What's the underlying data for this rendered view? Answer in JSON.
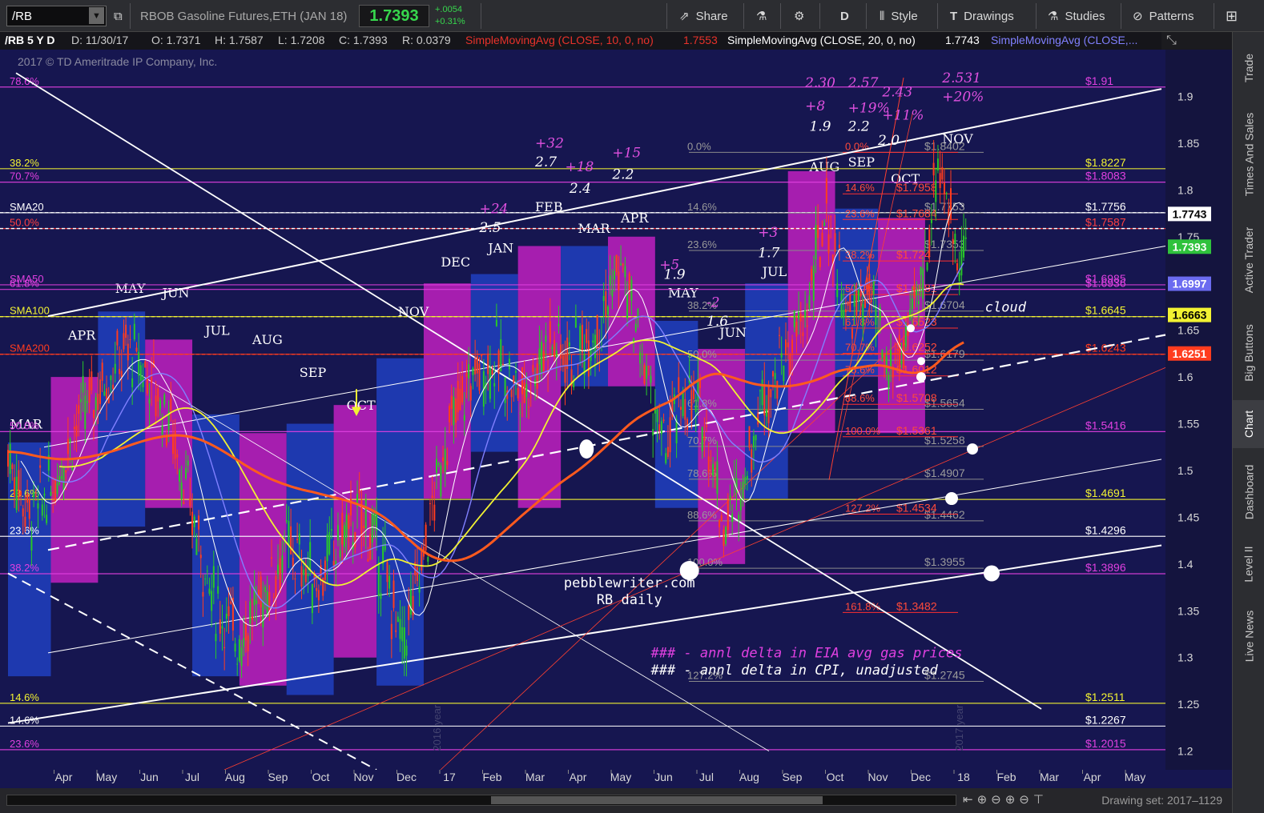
{
  "toolbar": {
    "symbol": "/RB",
    "description": "RBOB Gasoline Futures,ETH (JAN 18)",
    "last": "1.7393",
    "change": "+.0054",
    "change_pct": "+0.31%",
    "buttons": [
      "Share",
      "D",
      "Style",
      "Drawings",
      "Studies",
      "Patterns"
    ]
  },
  "study_header": {
    "symbol_period": "/RB 5 Y D",
    "date": "D: 11/30/17",
    "open": "O: 1.7371",
    "high": "H: 1.7587",
    "low": "L: 1.7208",
    "close": "C: 1.7393",
    "range": "R: 0.0379",
    "sma10_label": "SimpleMovingAvg (CLOSE, 10, 0, no)",
    "sma10_value": "1.7553",
    "sma20_label": "SimpleMovingAvg (CLOSE, 20, 0, no)",
    "sma20_value": "1.7743",
    "sma50_label": "SimpleMovingAvg (CLOSE,...",
    "colors": {
      "sma10": "#e8322a",
      "sma20": "#ffffff",
      "sma50": "#8080ff",
      "sma100": "#f2f232",
      "sma200": "#ff5a1e"
    }
  },
  "watermark": "2017 © TD Ameritrade IP Company, Inc.",
  "right_tabs": [
    "Trade",
    "Times And Sales",
    "Active Trader",
    "Big Buttons",
    "Chart",
    "Dashboard",
    "Level II",
    "Live News"
  ],
  "bottom_bar": {
    "drawing_set": "Drawing set: 2017–1129"
  },
  "chart_data": {
    "type": "candlestick",
    "ylim": [
      1.18,
      1.95
    ],
    "y_ticks": [
      "1.9",
      "1.85",
      "1.8",
      "1.75",
      "1.7",
      "1.65",
      "1.6",
      "1.55",
      "1.5",
      "1.45",
      "1.4",
      "1.35",
      "1.3",
      "1.25",
      "1.2"
    ],
    "x_ticks": [
      "Apr",
      "May",
      "Jun",
      "Jul",
      "Aug",
      "Sep",
      "Oct",
      "Nov",
      "Dec",
      "17",
      "Feb",
      "Mar",
      "Apr",
      "May",
      "Jun",
      "Jul",
      "Aug",
      "Sep",
      "Oct",
      "Nov",
      "Dec",
      "18",
      "Feb",
      "Mar",
      "Apr",
      "May"
    ],
    "year_markers": [
      "2016 year",
      "2017 year"
    ],
    "price_badges": [
      {
        "text": "1.7743",
        "value": 1.7743,
        "bg": "#ffffff",
        "fg": "#000000"
      },
      {
        "text": "1.7393",
        "value": 1.7393,
        "bg": "#2fc23c",
        "fg": "#ffffff"
      },
      {
        "text": "1.6997",
        "value": 1.6997,
        "bg": "#6b6bf0",
        "fg": "#ffffff"
      },
      {
        "text": "1.6663",
        "value": 1.6663,
        "bg": "#f2f232",
        "fg": "#000000"
      },
      {
        "text": "1.6251",
        "value": 1.6251,
        "bg": "#ff3c1e",
        "fg": "#ffffff"
      }
    ],
    "level_lines": [
      {
        "label": "78.6%",
        "price": "$1.91",
        "value": 1.91,
        "color": "#e040e0"
      },
      {
        "label": "38.2%",
        "price": "$1.8227",
        "value": 1.8227,
        "color": "#f2f232"
      },
      {
        "label": "70.7%",
        "price": "$1.8083",
        "value": 1.8083,
        "color": "#e040e0"
      },
      {
        "label": "SMA20",
        "price": "$1.7756",
        "value": 1.7756,
        "color": "#ffffff"
      },
      {
        "label": "50.0%",
        "price": "$1.7587",
        "value": 1.7587,
        "color": "#ff4040"
      },
      {
        "label": "61.8%",
        "price": "$1.6936",
        "value": 1.6936,
        "color": "#e040e0"
      },
      {
        "label": "SMA50",
        "price": "$1.6985",
        "value": 1.6985,
        "color": "#e040e0"
      },
      {
        "label": "SMA100",
        "price": "$1.6645",
        "value": 1.6645,
        "color": "#f2f232"
      },
      {
        "label": "SMA200",
        "price": "$1.6243",
        "value": 1.6243,
        "color": "#ff3c1e"
      },
      {
        "label": "50.0%",
        "price": "$1.5416",
        "value": 1.5416,
        "color": "#e040e0"
      },
      {
        "label": "23.6%",
        "price": "$1.4691",
        "value": 1.4691,
        "color": "#f2f232"
      },
      {
        "label": "23.6%",
        "price": "$1.4296",
        "value": 1.4296,
        "color": "#ffffff"
      },
      {
        "label": "38.2%",
        "price": "$1.3896",
        "value": 1.3896,
        "color": "#e040e0"
      },
      {
        "label": "14.6%",
        "price": "$1.2511",
        "value": 1.2511,
        "color": "#f2f232"
      },
      {
        "label": "14.6%",
        "price": "$1.2267",
        "value": 1.2267,
        "color": "#ffffff"
      },
      {
        "label": "23.6%",
        "price": "$1.2015",
        "value": 1.2015,
        "color": "#e040e0"
      }
    ],
    "grey_fib": [
      {
        "label": "0.0%",
        "price": "$1.8402",
        "value": 1.8402
      },
      {
        "label": "14.6%",
        "price": "$1.7753",
        "value": 1.7753
      },
      {
        "label": "23.6%",
        "price": "$1.7353",
        "value": 1.7353
      },
      {
        "label": "38.2%",
        "price": "$1.6704",
        "value": 1.6704
      },
      {
        "label": "50.0%",
        "price": "$1.6179",
        "value": 1.6179
      },
      {
        "label": "61.8%",
        "price": "$1.5654",
        "value": 1.5654
      },
      {
        "label": "70.7%",
        "price": "$1.5258",
        "value": 1.5258
      },
      {
        "label": "78.6%",
        "price": "$1.4907",
        "value": 1.4907
      },
      {
        "label": "88.6%",
        "price": "$1.4462",
        "value": 1.4462
      },
      {
        "label": "100.0%",
        "price": "$1.3955",
        "value": 1.3955
      },
      {
        "label": "127.2%",
        "price": "$1.2745",
        "value": 1.2745
      }
    ],
    "red_fib": [
      {
        "label": "0.0%",
        "value": 1.8402
      },
      {
        "label": "14.6%",
        "price": "$1.7958",
        "value": 1.7958
      },
      {
        "label": "23.6%",
        "price": "$1.7684",
        "value": 1.7684
      },
      {
        "label": "38.2%",
        "price": "$1.724",
        "value": 1.724
      },
      {
        "label": "50.0%",
        "price": "$1.6881",
        "value": 1.6881
      },
      {
        "label": "61.8%",
        "price": "$1.6523",
        "value": 1.6523
      },
      {
        "label": "70.7%",
        "price": "$1.6252",
        "value": 1.6252
      },
      {
        "label": "78.6%",
        "price": "$1.6012",
        "value": 1.6012
      },
      {
        "label": "88.6%",
        "price": "$1.5708",
        "value": 1.5708
      },
      {
        "label": "100.0%",
        "price": "$1.5361",
        "value": 1.5361
      },
      {
        "label": "127.2%",
        "price": "$1.4534",
        "value": 1.4534
      },
      {
        "label": "161.8%",
        "price": "$1.3482",
        "value": 1.3482
      }
    ],
    "seasonal_boxes": [
      {
        "label": "MAR",
        "color": "#2040c0",
        "start": 0,
        "end": 1,
        "low": 1.28,
        "high": 1.53
      },
      {
        "label": "APR",
        "color": "#c020c0",
        "start": 1,
        "end": 2.1,
        "low": 1.38,
        "high": 1.6
      },
      {
        "label": "MAY",
        "color": "#2040c0",
        "start": 2.1,
        "end": 3.2,
        "low": 1.44,
        "high": 1.67
      },
      {
        "label": "JUN",
        "color": "#c020c0",
        "start": 3.2,
        "end": 4.3,
        "low": 1.46,
        "high": 1.64
      },
      {
        "label": "JUL",
        "color": "#2040c0",
        "start": 4.3,
        "end": 5.4,
        "low": 1.28,
        "high": 1.56
      },
      {
        "label": "AUG",
        "color": "#c020c0",
        "start": 5.4,
        "end": 6.5,
        "low": 1.27,
        "high": 1.54
      },
      {
        "label": "SEP",
        "color": "#2040c0",
        "start": 6.5,
        "end": 7.6,
        "low": 1.26,
        "high": 1.55
      },
      {
        "label": "OCT",
        "color": "#c020c0",
        "start": 7.6,
        "end": 8.6,
        "low": 1.3,
        "high": 1.57
      },
      {
        "label": "NOV",
        "color": "#2040c0",
        "start": 8.6,
        "end": 9.7,
        "low": 1.27,
        "high": 1.62
      },
      {
        "label": "DEC",
        "color": "#c020c0",
        "start": 9.7,
        "end": 10.8,
        "low": 1.47,
        "high": 1.7
      },
      {
        "label": "JAN",
        "color": "#2040c0",
        "start": 10.8,
        "end": 11.9,
        "low": 1.52,
        "high": 1.71
      },
      {
        "label": "FEB",
        "color": "#c020c0",
        "start": 11.9,
        "end": 12.9,
        "low": 1.46,
        "high": 1.74
      },
      {
        "label": "MAR",
        "color": "#2040c0",
        "start": 12.9,
        "end": 14,
        "low": 1.59,
        "high": 1.74
      },
      {
        "label": "APR",
        "color": "#c020c0",
        "start": 14,
        "end": 15.1,
        "low": 1.59,
        "high": 1.75
      },
      {
        "label": "MAY",
        "color": "#2040c0",
        "start": 15.1,
        "end": 16.1,
        "low": 1.46,
        "high": 1.66
      },
      {
        "label": "JUN",
        "color": "#c020c0",
        "start": 16.1,
        "end": 17.2,
        "low": 1.4,
        "high": 1.63
      },
      {
        "label": "JUL",
        "color": "#2040c0",
        "start": 17.2,
        "end": 18.2,
        "low": 1.47,
        "high": 1.7
      },
      {
        "label": "AUG",
        "color": "#c020c0",
        "start": 18.2,
        "end": 19.3,
        "low": 1.54,
        "high": 1.82
      },
      {
        "label": "SEP",
        "color": "#2040c0",
        "start": 19.3,
        "end": 20.3,
        "low": 1.6,
        "high": 1.78
      },
      {
        "label": "OCT",
        "color": "#c020c0",
        "start": 20.3,
        "end": 21.4,
        "low": 1.54,
        "high": 1.77
      }
    ],
    "month_labels": [
      {
        "text": "MAR",
        "m": 0.05,
        "v": 1.545
      },
      {
        "text": "APR",
        "m": 1.4,
        "v": 1.64
      },
      {
        "text": "MAY",
        "m": 2.5,
        "v": 1.69
      },
      {
        "text": "JUN",
        "m": 3.6,
        "v": 1.685
      },
      {
        "text": "JUL",
        "m": 4.6,
        "v": 1.645
      },
      {
        "text": "AUG",
        "m": 5.7,
        "v": 1.635
      },
      {
        "text": "SEP",
        "m": 6.8,
        "v": 1.6
      },
      {
        "text": "OCT",
        "m": 7.9,
        "v": 1.565
      },
      {
        "text": "NOV",
        "m": 9.1,
        "v": 1.665
      },
      {
        "text": "DEC",
        "m": 10.1,
        "v": 1.718
      },
      {
        "text": "JAN",
        "m": 11.2,
        "v": 1.733
      },
      {
        "text": "FEB",
        "m": 12.3,
        "v": 1.777
      },
      {
        "text": "MAR",
        "m": 13.3,
        "v": 1.754
      },
      {
        "text": "APR",
        "m": 14.3,
        "v": 1.765
      },
      {
        "text": "MAY",
        "m": 15.4,
        "v": 1.685
      },
      {
        "text": "JUN",
        "m": 16.6,
        "v": 1.643
      },
      {
        "text": "JUL",
        "m": 17.6,
        "v": 1.708
      },
      {
        "text": "AUG",
        "m": 18.7,
        "v": 1.82
      },
      {
        "text": "SEP",
        "m": 19.6,
        "v": 1.825
      },
      {
        "text": "OCT",
        "m": 20.6,
        "v": 1.807
      },
      {
        "text": "NOV",
        "m": 21.8,
        "v": 1.85
      }
    ],
    "annotations_eia": [
      {
        "text": "+24",
        "m": 11,
        "v": 1.775
      },
      {
        "text": "+32",
        "m": 12.3,
        "v": 1.845
      },
      {
        "text": "+18",
        "m": 13,
        "v": 1.82
      },
      {
        "text": "+15",
        "m": 14.1,
        "v": 1.835
      },
      {
        "text": "+5",
        "m": 15.2,
        "v": 1.715
      },
      {
        "text": "-2",
        "m": 16.3,
        "v": 1.675
      },
      {
        "text": "+3",
        "m": 17.5,
        "v": 1.75
      },
      {
        "text": "2.30",
        "m": 18.6,
        "v": 1.91
      },
      {
        "text": "+8",
        "m": 18.6,
        "v": 1.885
      },
      {
        "text": "2.57",
        "m": 19.6,
        "v": 1.91
      },
      {
        "text": "+19%",
        "m": 19.6,
        "v": 1.883
      },
      {
        "text": "2.43",
        "m": 20.4,
        "v": 1.9
      },
      {
        "text": "+11%",
        "m": 20.4,
        "v": 1.875
      },
      {
        "text": "2.531",
        "m": 21.8,
        "v": 1.915
      },
      {
        "text": "+20%",
        "m": 21.8,
        "v": 1.895
      }
    ],
    "annotations_cpi": [
      {
        "text": "2.5",
        "m": 11,
        "v": 1.755
      },
      {
        "text": "2.7",
        "m": 12.3,
        "v": 1.825
      },
      {
        "text": "2.4",
        "m": 13.1,
        "v": 1.797
      },
      {
        "text": "2.2",
        "m": 14.1,
        "v": 1.812
      },
      {
        "text": "1.9",
        "m": 15.3,
        "v": 1.705
      },
      {
        "text": "1.6",
        "m": 16.3,
        "v": 1.655
      },
      {
        "text": "1.7",
        "m": 17.5,
        "v": 1.728
      },
      {
        "text": "1.9",
        "m": 18.7,
        "v": 1.863
      },
      {
        "text": "2.2",
        "m": 19.6,
        "v": 1.863
      },
      {
        "text": "2.0",
        "m": 20.3,
        "v": 1.848
      }
    ],
    "text_notes": [
      {
        "text": "pebblewriter.com",
        "m": 14.5,
        "v": 1.375,
        "color": "#ffffff"
      },
      {
        "text": "RB daily",
        "m": 14.5,
        "v": 1.357,
        "color": "#ffffff"
      },
      {
        "text": "### - annl delta in EIA avg gas prices",
        "m": 15,
        "v": 1.3,
        "color": "#e040e0"
      },
      {
        "text": "### - annl delta in CPI, unadjusted",
        "m": 15,
        "v": 1.282,
        "color": "#ffffff"
      },
      {
        "text": "cloud",
        "m": 22.8,
        "v": 1.67,
        "color": "#ffffff"
      }
    ],
    "series": [
      {
        "name": "SMA20",
        "color": "#ffffff"
      },
      {
        "name": "SMA50",
        "color": "#8080ff"
      },
      {
        "name": "SMA100",
        "color": "#f2f232"
      },
      {
        "name": "SMA200",
        "color": "#ff5a1e"
      }
    ]
  }
}
